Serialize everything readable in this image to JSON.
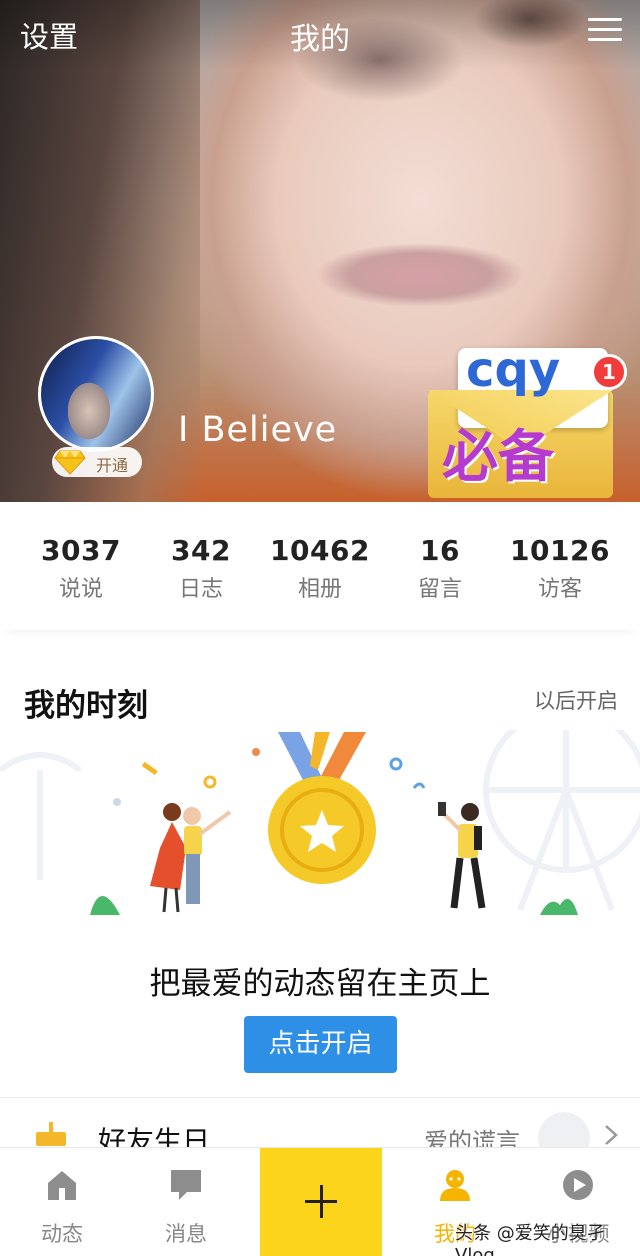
{
  "header": {
    "settings_label": "设置",
    "title": "我的",
    "menu_icon": "hamburger-menu-icon"
  },
  "profile": {
    "nickname": "I   Believe",
    "vip_label": "开通",
    "vip_icon": "diamond-icon"
  },
  "promo": {
    "line1": "cqy",
    "line2": "必备",
    "badge_count": "1"
  },
  "stats": [
    {
      "value": "3037",
      "label": "说说"
    },
    {
      "value": "342",
      "label": "日志"
    },
    {
      "value": "10462",
      "label": "相册"
    },
    {
      "value": "16",
      "label": "留言"
    },
    {
      "value": "10126",
      "label": "访客"
    }
  ],
  "moments": {
    "title": "我的时刻",
    "later_label": "以后开启",
    "description": "把最爱的动态留在主页上",
    "button_label": "点击开启"
  },
  "birthday": {
    "title": "好友生日",
    "subtitle": "爱的谎言"
  },
  "tabs": [
    {
      "label": "动态",
      "icon": "house-icon"
    },
    {
      "label": "消息",
      "icon": "chat-bubble-icon"
    },
    {
      "label": "",
      "icon": "plus-icon"
    },
    {
      "label": "我的",
      "icon": "person-icon",
      "active": true
    },
    {
      "label": "小视频",
      "icon": "video-play-icon"
    }
  ],
  "watermark": "头条 @爱笑的臭孑Vlog",
  "colors": {
    "accent_yellow": "#fcd41c",
    "button_blue": "#2d8fe6",
    "badge_red": "#f23b3b",
    "active_tab": "#f5b400"
  }
}
